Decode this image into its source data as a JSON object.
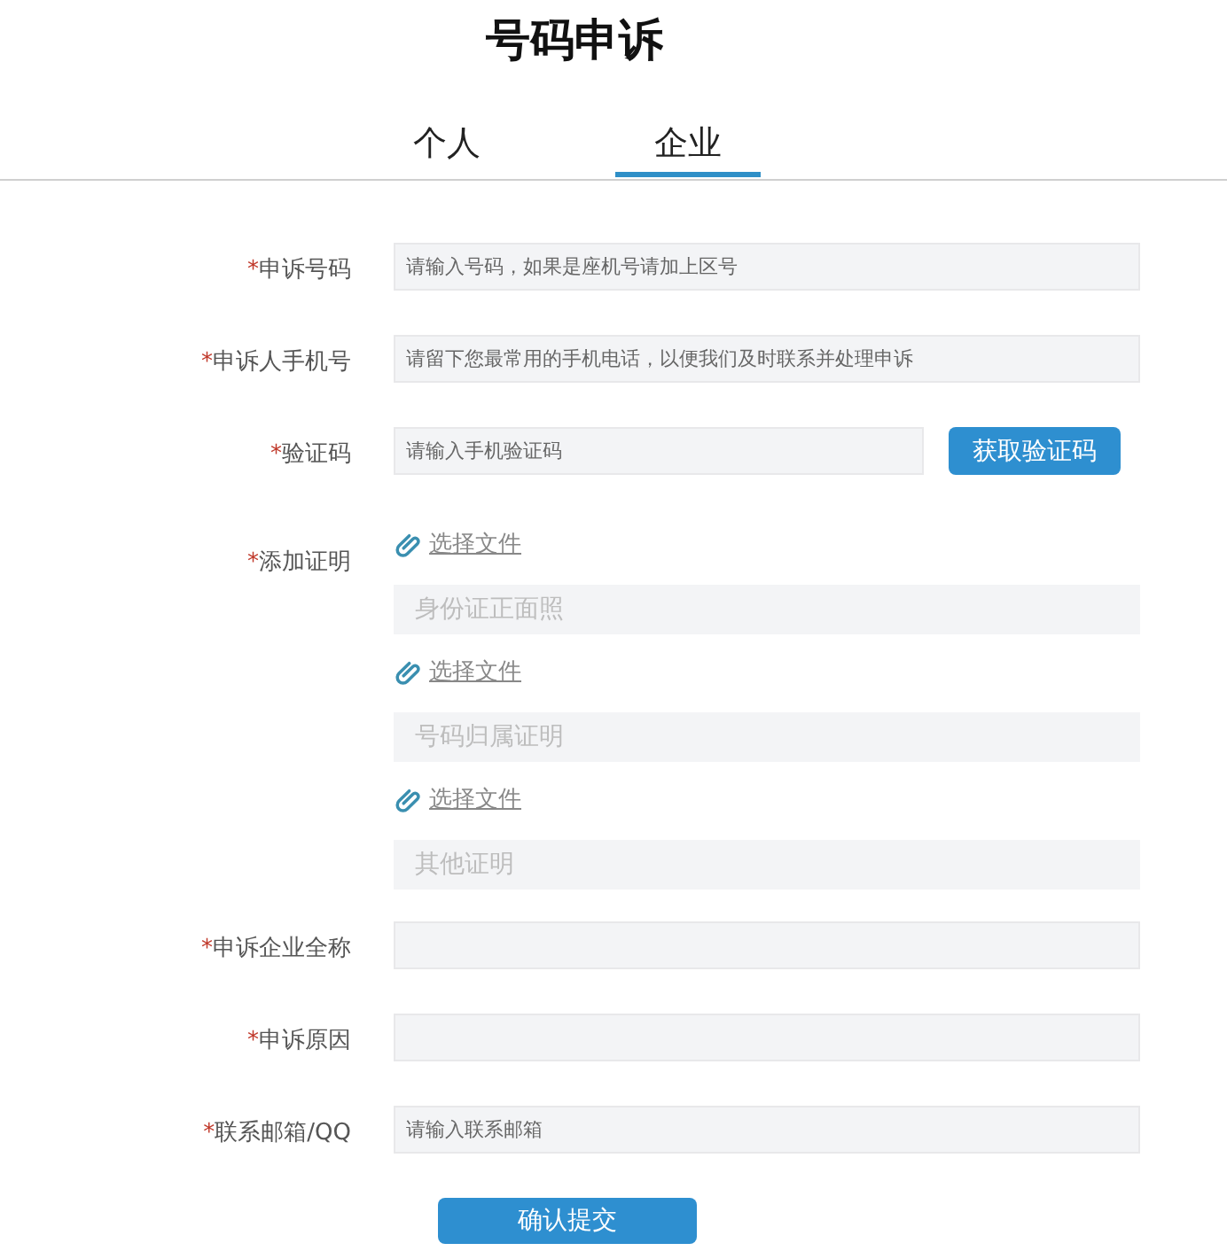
{
  "title": "号码申诉",
  "tabs": [
    {
      "label": "个人",
      "selected": false
    },
    {
      "label": "企业",
      "selected": true
    }
  ],
  "fields": [
    {
      "kind": "text",
      "mark": "*",
      "label": "申诉号码",
      "placeholder": "请输入号码，如果是座机号请加上区号"
    },
    {
      "kind": "text",
      "mark": "*",
      "label": "申诉人手机号",
      "placeholder": "请留下您最常用的手机电话，以便我们及时联系并处理申诉"
    },
    {
      "kind": "code",
      "mark": "*",
      "label": "验证码",
      "placeholder": "请输入手机验证码",
      "button": "获取验证码"
    },
    {
      "kind": "files",
      "mark": "*",
      "label": "添加证明",
      "files": [
        {
          "link": "选择文件",
          "placeholder": "身份证正面照"
        },
        {
          "link": "选择文件",
          "placeholder": "号码归属证明"
        },
        {
          "link": "选择文件",
          "placeholder": "其他证明"
        }
      ]
    },
    {
      "kind": "text",
      "mark": "*",
      "label": "申诉企业全称"
    },
    {
      "kind": "text",
      "mark": "*",
      "label": "申诉原因"
    },
    {
      "kind": "text",
      "mark": "*",
      "label": "联系邮箱/QQ",
      "placeholder": "请输入联系邮箱"
    }
  ],
  "submit": "确认提交"
}
